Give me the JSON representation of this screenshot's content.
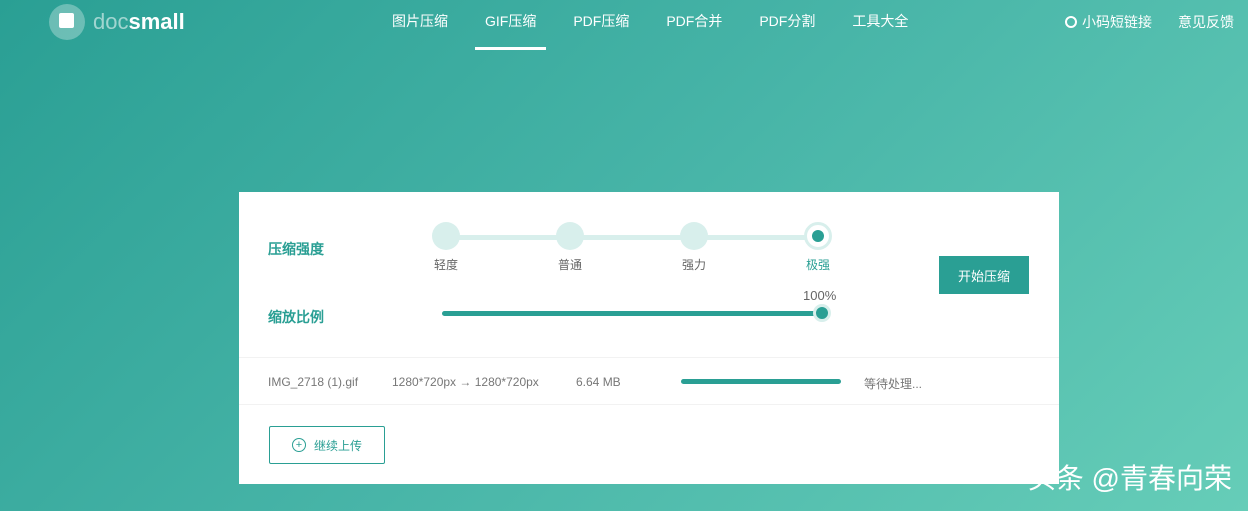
{
  "logo": {
    "doc": "doc",
    "small": "small"
  },
  "nav": [
    "图片压缩",
    "GIF压缩",
    "PDF压缩",
    "PDF合并",
    "PDF分割",
    "工具大全"
  ],
  "right": {
    "shortlink": "小码短链接",
    "feedback": "意见反馈"
  },
  "compress": {
    "strength_label": "压缩强度",
    "levels": [
      "轻度",
      "普通",
      "强力",
      "极强"
    ],
    "selected": 3,
    "scale_label": "缩放比例",
    "scale_value": "100%",
    "scale_fraction": 1.0,
    "start_button": "开始压缩"
  },
  "file": {
    "name": "IMG_2718 (1).gif",
    "dims": "1280*720px → 1280*720px",
    "size": "6.64 MB",
    "status": "等待处理...",
    "progress": 1.0
  },
  "upload_button": "继续上传",
  "watermark": "头条 @青春向荣",
  "colors": {
    "accent": "#2a9f94"
  }
}
